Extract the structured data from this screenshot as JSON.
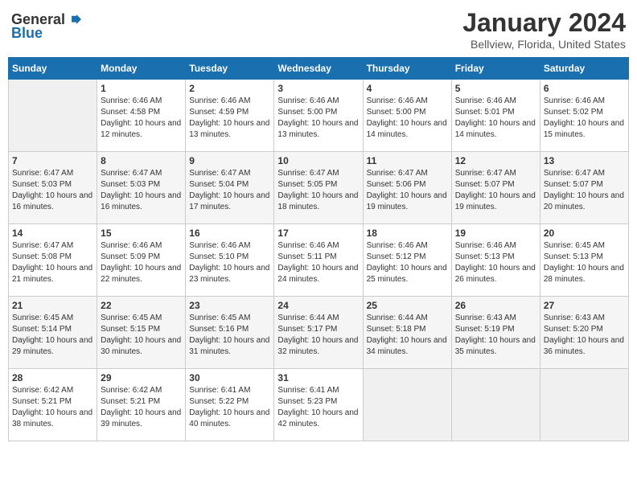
{
  "logo": {
    "general": "General",
    "blue": "Blue"
  },
  "header": {
    "title": "January 2024",
    "subtitle": "Bellview, Florida, United States"
  },
  "days_of_week": [
    "Sunday",
    "Monday",
    "Tuesday",
    "Wednesday",
    "Thursday",
    "Friday",
    "Saturday"
  ],
  "weeks": [
    [
      {
        "day": "",
        "sunrise": "",
        "sunset": "",
        "daylight": ""
      },
      {
        "day": "1",
        "sunrise": "Sunrise: 6:46 AM",
        "sunset": "Sunset: 4:58 PM",
        "daylight": "Daylight: 10 hours and 12 minutes."
      },
      {
        "day": "2",
        "sunrise": "Sunrise: 6:46 AM",
        "sunset": "Sunset: 4:59 PM",
        "daylight": "Daylight: 10 hours and 13 minutes."
      },
      {
        "day": "3",
        "sunrise": "Sunrise: 6:46 AM",
        "sunset": "Sunset: 5:00 PM",
        "daylight": "Daylight: 10 hours and 13 minutes."
      },
      {
        "day": "4",
        "sunrise": "Sunrise: 6:46 AM",
        "sunset": "Sunset: 5:00 PM",
        "daylight": "Daylight: 10 hours and 14 minutes."
      },
      {
        "day": "5",
        "sunrise": "Sunrise: 6:46 AM",
        "sunset": "Sunset: 5:01 PM",
        "daylight": "Daylight: 10 hours and 14 minutes."
      },
      {
        "day": "6",
        "sunrise": "Sunrise: 6:46 AM",
        "sunset": "Sunset: 5:02 PM",
        "daylight": "Daylight: 10 hours and 15 minutes."
      }
    ],
    [
      {
        "day": "7",
        "sunrise": "Sunrise: 6:47 AM",
        "sunset": "Sunset: 5:03 PM",
        "daylight": "Daylight: 10 hours and 16 minutes."
      },
      {
        "day": "8",
        "sunrise": "Sunrise: 6:47 AM",
        "sunset": "Sunset: 5:03 PM",
        "daylight": "Daylight: 10 hours and 16 minutes."
      },
      {
        "day": "9",
        "sunrise": "Sunrise: 6:47 AM",
        "sunset": "Sunset: 5:04 PM",
        "daylight": "Daylight: 10 hours and 17 minutes."
      },
      {
        "day": "10",
        "sunrise": "Sunrise: 6:47 AM",
        "sunset": "Sunset: 5:05 PM",
        "daylight": "Daylight: 10 hours and 18 minutes."
      },
      {
        "day": "11",
        "sunrise": "Sunrise: 6:47 AM",
        "sunset": "Sunset: 5:06 PM",
        "daylight": "Daylight: 10 hours and 19 minutes."
      },
      {
        "day": "12",
        "sunrise": "Sunrise: 6:47 AM",
        "sunset": "Sunset: 5:07 PM",
        "daylight": "Daylight: 10 hours and 19 minutes."
      },
      {
        "day": "13",
        "sunrise": "Sunrise: 6:47 AM",
        "sunset": "Sunset: 5:07 PM",
        "daylight": "Daylight: 10 hours and 20 minutes."
      }
    ],
    [
      {
        "day": "14",
        "sunrise": "Sunrise: 6:47 AM",
        "sunset": "Sunset: 5:08 PM",
        "daylight": "Daylight: 10 hours and 21 minutes."
      },
      {
        "day": "15",
        "sunrise": "Sunrise: 6:46 AM",
        "sunset": "Sunset: 5:09 PM",
        "daylight": "Daylight: 10 hours and 22 minutes."
      },
      {
        "day": "16",
        "sunrise": "Sunrise: 6:46 AM",
        "sunset": "Sunset: 5:10 PM",
        "daylight": "Daylight: 10 hours and 23 minutes."
      },
      {
        "day": "17",
        "sunrise": "Sunrise: 6:46 AM",
        "sunset": "Sunset: 5:11 PM",
        "daylight": "Daylight: 10 hours and 24 minutes."
      },
      {
        "day": "18",
        "sunrise": "Sunrise: 6:46 AM",
        "sunset": "Sunset: 5:12 PM",
        "daylight": "Daylight: 10 hours and 25 minutes."
      },
      {
        "day": "19",
        "sunrise": "Sunrise: 6:46 AM",
        "sunset": "Sunset: 5:13 PM",
        "daylight": "Daylight: 10 hours and 26 minutes."
      },
      {
        "day": "20",
        "sunrise": "Sunrise: 6:45 AM",
        "sunset": "Sunset: 5:13 PM",
        "daylight": "Daylight: 10 hours and 28 minutes."
      }
    ],
    [
      {
        "day": "21",
        "sunrise": "Sunrise: 6:45 AM",
        "sunset": "Sunset: 5:14 PM",
        "daylight": "Daylight: 10 hours and 29 minutes."
      },
      {
        "day": "22",
        "sunrise": "Sunrise: 6:45 AM",
        "sunset": "Sunset: 5:15 PM",
        "daylight": "Daylight: 10 hours and 30 minutes."
      },
      {
        "day": "23",
        "sunrise": "Sunrise: 6:45 AM",
        "sunset": "Sunset: 5:16 PM",
        "daylight": "Daylight: 10 hours and 31 minutes."
      },
      {
        "day": "24",
        "sunrise": "Sunrise: 6:44 AM",
        "sunset": "Sunset: 5:17 PM",
        "daylight": "Daylight: 10 hours and 32 minutes."
      },
      {
        "day": "25",
        "sunrise": "Sunrise: 6:44 AM",
        "sunset": "Sunset: 5:18 PM",
        "daylight": "Daylight: 10 hours and 34 minutes."
      },
      {
        "day": "26",
        "sunrise": "Sunrise: 6:43 AM",
        "sunset": "Sunset: 5:19 PM",
        "daylight": "Daylight: 10 hours and 35 minutes."
      },
      {
        "day": "27",
        "sunrise": "Sunrise: 6:43 AM",
        "sunset": "Sunset: 5:20 PM",
        "daylight": "Daylight: 10 hours and 36 minutes."
      }
    ],
    [
      {
        "day": "28",
        "sunrise": "Sunrise: 6:42 AM",
        "sunset": "Sunset: 5:21 PM",
        "daylight": "Daylight: 10 hours and 38 minutes."
      },
      {
        "day": "29",
        "sunrise": "Sunrise: 6:42 AM",
        "sunset": "Sunset: 5:21 PM",
        "daylight": "Daylight: 10 hours and 39 minutes."
      },
      {
        "day": "30",
        "sunrise": "Sunrise: 6:41 AM",
        "sunset": "Sunset: 5:22 PM",
        "daylight": "Daylight: 10 hours and 40 minutes."
      },
      {
        "day": "31",
        "sunrise": "Sunrise: 6:41 AM",
        "sunset": "Sunset: 5:23 PM",
        "daylight": "Daylight: 10 hours and 42 minutes."
      },
      {
        "day": "",
        "sunrise": "",
        "sunset": "",
        "daylight": ""
      },
      {
        "day": "",
        "sunrise": "",
        "sunset": "",
        "daylight": ""
      },
      {
        "day": "",
        "sunrise": "",
        "sunset": "",
        "daylight": ""
      }
    ]
  ]
}
